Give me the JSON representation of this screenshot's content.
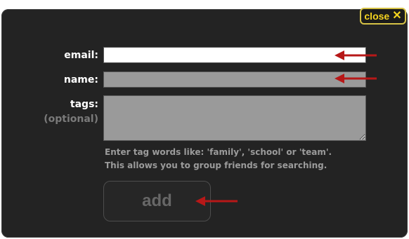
{
  "close": {
    "label": "close",
    "icon": "close-icon"
  },
  "form": {
    "email_label": "email:",
    "name_label": "name:",
    "tags_label": "tags:",
    "tags_optional": "(optional)",
    "email_value": "",
    "name_value": "",
    "tags_value": ""
  },
  "hint": {
    "line1": "Enter tag words like: 'family', 'school' or 'team'.",
    "line2": "This allows you to group friends for searching."
  },
  "add_button": {
    "label": "add"
  },
  "colors": {
    "dialog_bg": "#232323",
    "close_accent": "#f4d31f",
    "annotation_arrow": "#b71818"
  }
}
